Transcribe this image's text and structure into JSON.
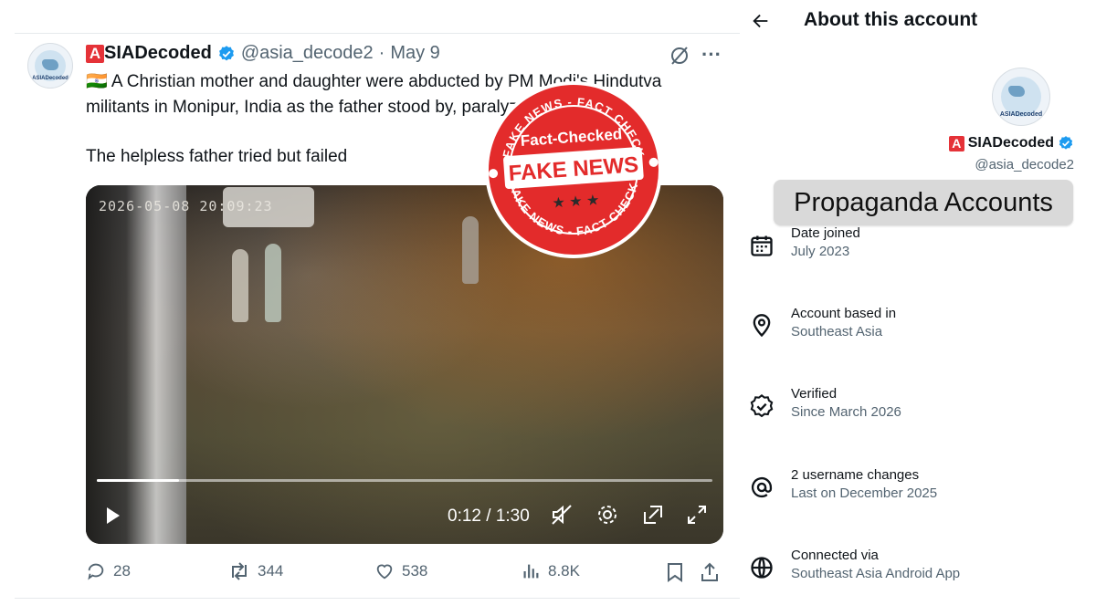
{
  "tweet": {
    "display_name": "SIADecoded",
    "brand_letter": "A",
    "handle": "@asia_decode2",
    "dot": "·",
    "date": "May 9",
    "more": "···",
    "flag": "🇮🇳",
    "text_line1": "A Christian mother and daughter were abducted by PM Modi's Hindutva",
    "text_line2": "militants in Monipur, India as the father stood by, paralyzed in terror.",
    "text_line3": "The helpless father tried but failed",
    "avatar_caption": "ASIADecoded"
  },
  "media": {
    "cctv_timestamp": "2026-05-08 20:09:23",
    "time_readout": "0:12 / 1:30",
    "progress": 0.133
  },
  "actions": {
    "replies": "28",
    "reposts": "344",
    "likes": "538",
    "views": "8.8K"
  },
  "stamp": {
    "ring_top": "FAKE NEWS - FACT CHECK",
    "ring_bottom": "FAKE NEWS - FACT CHECK",
    "fact_checked": "Fact-Checked",
    "fake_news": "FAKE NEWS",
    "color": "#e32b2b"
  },
  "panel": {
    "title": "About this account",
    "display_name": "SIADecoded",
    "brand_letter": "A",
    "handle": "@asia_decode2",
    "avatar_caption": "ASIADecoded",
    "label": "Propaganda Accounts",
    "rows": [
      {
        "title": "Date joined",
        "sub": "July 2023"
      },
      {
        "title": "Account based in",
        "sub": "Southeast Asia"
      },
      {
        "title": "Verified",
        "sub": "Since March 2026"
      },
      {
        "title": "2 username changes",
        "sub": "Last on December 2025"
      },
      {
        "title": "Connected via",
        "sub": "Southeast Asia Android App"
      }
    ]
  },
  "colors": {
    "brand_red": "#e53238",
    "verified_blue": "#1d9bf0",
    "muted_text": "#536471"
  }
}
